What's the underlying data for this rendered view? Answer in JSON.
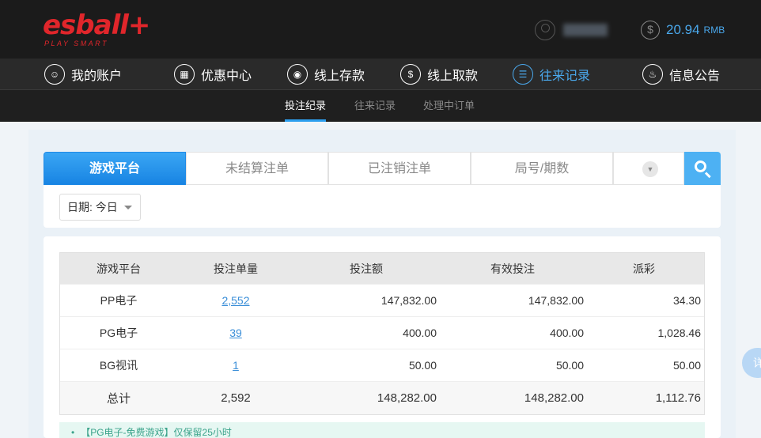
{
  "header": {
    "logo": "esball+",
    "logo_sub": "PLAY SMART",
    "balance": "20.94",
    "currency": "RMB"
  },
  "nav": {
    "items": [
      {
        "label": "我的账户",
        "icon": "user-icon"
      },
      {
        "label": "优惠中心",
        "icon": "gift-icon"
      },
      {
        "label": "线上存款",
        "icon": "deposit-icon"
      },
      {
        "label": "线上取款",
        "icon": "withdraw-icon"
      },
      {
        "label": "往来记录",
        "icon": "records-icon",
        "active": true
      },
      {
        "label": "信息公告",
        "icon": "bell-icon"
      }
    ]
  },
  "subnav": {
    "items": [
      {
        "label": "投注纪录",
        "active": true
      },
      {
        "label": "往来记录"
      },
      {
        "label": "处理中订单"
      }
    ]
  },
  "filter": {
    "tabs": [
      "游戏平台",
      "未结算注单",
      "已注销注单",
      "局号/期数"
    ],
    "date_label": "日期: 今日"
  },
  "table": {
    "headers": [
      "游戏平台",
      "投注单量",
      "投注额",
      "有效投注",
      "派彩"
    ],
    "rows": [
      {
        "platform": "PP电子",
        "count": "2,552",
        "amount": "147,832.00",
        "valid": "147,832.00",
        "payout": "34.30"
      },
      {
        "platform": "PG电子",
        "count": "39",
        "amount": "400.00",
        "valid": "400.00",
        "payout": "1,028.46"
      },
      {
        "platform": "BG视讯",
        "count": "1",
        "amount": "50.00",
        "valid": "50.00",
        "payout": "50.00"
      }
    ],
    "total": {
      "label": "总计",
      "count": "2,592",
      "amount": "148,282.00",
      "valid": "148,282.00",
      "payout": "1,112.76"
    }
  },
  "note": "【PG电子-免费游戏】仅保留25小时",
  "float_tab": "详",
  "colors": {
    "accent": "#2d9fee",
    "brand": "#e0262b",
    "balance": "#4aa8ec"
  }
}
